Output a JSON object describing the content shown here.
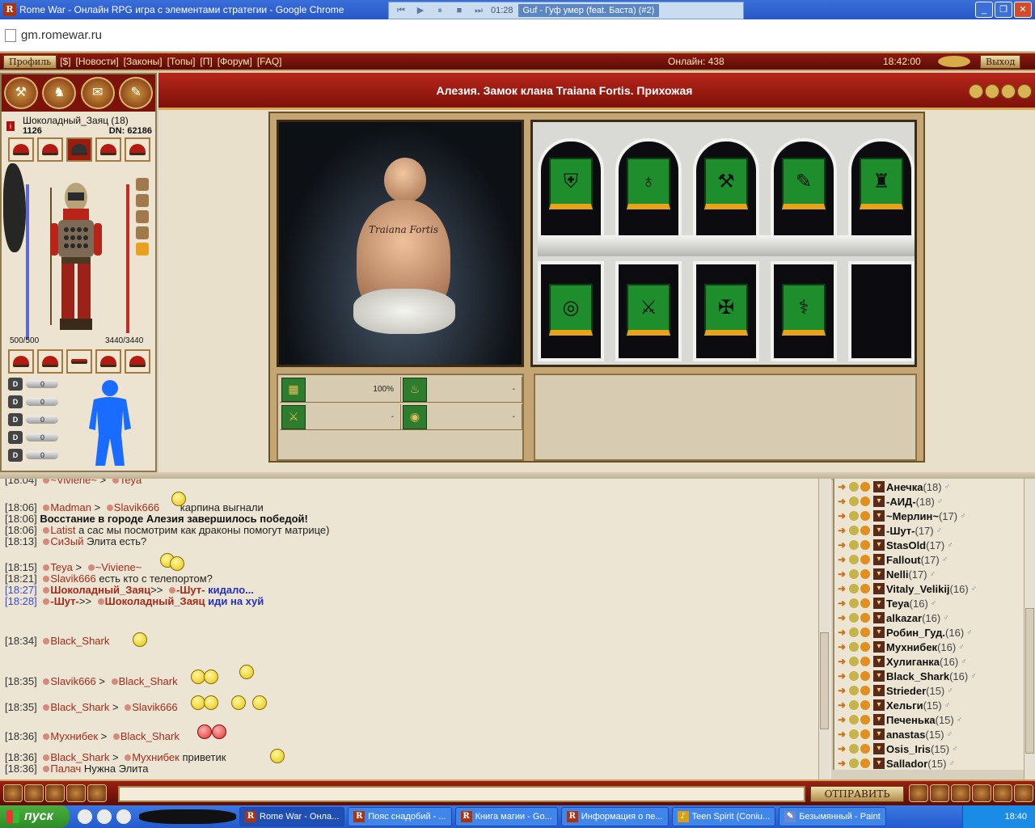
{
  "browser": {
    "title": "Rome War - Онлайн RPG игра с элементами стратегии - Google Chrome",
    "url": "gm.romewar.ru",
    "media_player": {
      "time": "01:28",
      "track": "Guf - Гуф умер (feat. Баста) (#2)"
    }
  },
  "topmenu": {
    "profile": "Профиль",
    "links": [
      "[$]",
      "[Новости]",
      "[Законы]",
      "[Топы]",
      "[П]",
      "[Форум]",
      "[FAQ]"
    ],
    "online": "Онлайн: 438",
    "clock": "18:42:00",
    "exit": "Выход"
  },
  "character": {
    "name": "Шоколадный_Заяц (18)",
    "value1": "1126",
    "dn": "DN: 62186",
    "hp": "500/500",
    "mp": "3440/3440",
    "attrs": [
      "0",
      "0",
      "0",
      "0",
      "0"
    ]
  },
  "location": {
    "title": "Алезия. Замок клана Traiana Fortis. Прихожая",
    "image_tattoo": "Traiana Fortis"
  },
  "stats": {
    "wall": "100%",
    "fire": "-",
    "sword": "-",
    "shield": "-"
  },
  "chat": {
    "lines": [
      {
        "time": "[18:04]",
        "from": "~Viviene~",
        "to": "Teya",
        "msg": ""
      },
      {
        "time": "[18:06]",
        "from": "Madman",
        "to": "Slavik666",
        "msg": "карпина выгнали"
      },
      {
        "time": "[18:06]",
        "sys": "Восстание в городе Алезия завершилось победой!"
      },
      {
        "time": "[18:06]",
        "from": "Latist",
        "msg": "а сас мы посмотрим как драконы помогут матрице)"
      },
      {
        "time": "[18:13]",
        "from": "СиЗый",
        "msg": "Элита есть?"
      },
      {
        "time": "[18:15]",
        "from": "Teya",
        "to": "~Viviene~",
        "msg": ""
      },
      {
        "time": "[18:21]",
        "from": "Slavik666",
        "msg": "есть кто с телепортом?"
      },
      {
        "time": "[18:27]",
        "from": "Шоколадный_Заяц",
        "to": "-Шут-",
        "msg": "кидало..."
      },
      {
        "time": "[18:28]",
        "from": "-Шут-",
        "to": "Шоколадный_Заяц",
        "msg": "иди на хуй"
      },
      {
        "time": "[18:34]",
        "from": "Black_Shark",
        "msg": ""
      },
      {
        "time": "[18:35]",
        "from": "Slavik666",
        "to": "Black_Shark",
        "msg": ""
      },
      {
        "time": "[18:35]",
        "from": "Black_Shark",
        "to": "Slavik666",
        "msg": ""
      },
      {
        "time": "[18:36]",
        "from": "Мухнибек",
        "to": "Black_Shark",
        "msg": ""
      },
      {
        "time": "[18:36]",
        "from": "Black_Shark",
        "to": "Мухнибек",
        "msg": "приветик"
      },
      {
        "time": "[18:36]",
        "from": "Палач",
        "msg": "Нужна Элита"
      }
    ]
  },
  "users": [
    {
      "name": "Анечка",
      "lvl": "(18)"
    },
    {
      "name": "-АИД-",
      "lvl": "(18)"
    },
    {
      "name": "~Мерлин~",
      "lvl": "(17)"
    },
    {
      "name": "-Шут-",
      "lvl": "(17)"
    },
    {
      "name": "StasOld",
      "lvl": "(17)"
    },
    {
      "name": "Fallout",
      "lvl": "(17)"
    },
    {
      "name": "Nelli",
      "lvl": "(17)"
    },
    {
      "name": "Vitaly_Velikij",
      "lvl": "(16)"
    },
    {
      "name": "Teya",
      "lvl": "(16)"
    },
    {
      "name": "alkazar",
      "lvl": "(16)"
    },
    {
      "name": "Робин_Гуд.",
      "lvl": "(16)"
    },
    {
      "name": "Мухнибек",
      "lvl": "(16)"
    },
    {
      "name": "Хулиганка",
      "lvl": "(16)"
    },
    {
      "name": "Black_Shark",
      "lvl": "(16)"
    },
    {
      "name": "Strieder",
      "lvl": "(15)"
    },
    {
      "name": "Хельги",
      "lvl": "(15)"
    },
    {
      "name": "Печенька",
      "lvl": "(15)"
    },
    {
      "name": "anastas",
      "lvl": "(15)"
    },
    {
      "name": "Osis_Iris",
      "lvl": "(15)"
    },
    {
      "name": "Sallador",
      "lvl": "(15)"
    }
  ],
  "bottombar": {
    "send": "ОТПРАВИТЬ"
  },
  "taskbar": {
    "start": "пуск",
    "tasks": [
      "Rome War - Онла...",
      "Пояс снадобий - ...",
      "Книга магии - Go...",
      "Информация о пе...",
      "Teen Spirit (Coniu...",
      "Безымянный - Paint"
    ],
    "clock": "18:40"
  }
}
